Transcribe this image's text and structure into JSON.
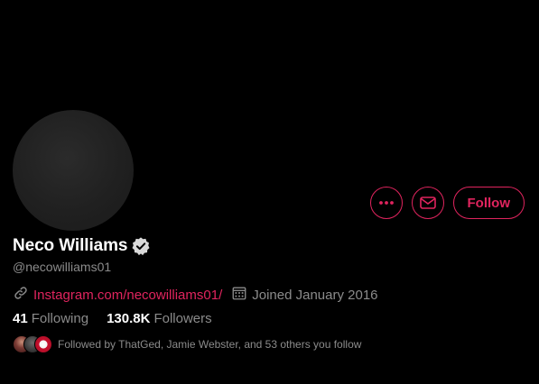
{
  "colors": {
    "accent": "#e0245e",
    "background": "#000000",
    "text_primary": "#ffffff",
    "text_secondary": "#8b8b8b"
  },
  "profile": {
    "display_name": "Neco Williams",
    "verified": true,
    "handle": "@necowilliams01",
    "website_label": "Instagram.com/necowilliams01/",
    "joined_text": "Joined January 2016"
  },
  "actions": {
    "more_icon": "more-icon",
    "message_icon": "mail-icon",
    "follow_label": "Follow"
  },
  "stats": {
    "following_count": "41",
    "following_label": "Following",
    "followers_count": "130.8K",
    "followers_label": "Followers"
  },
  "followed_by": {
    "text": "Followed by ThatGed, Jamie Webster, and 53 others you follow"
  }
}
